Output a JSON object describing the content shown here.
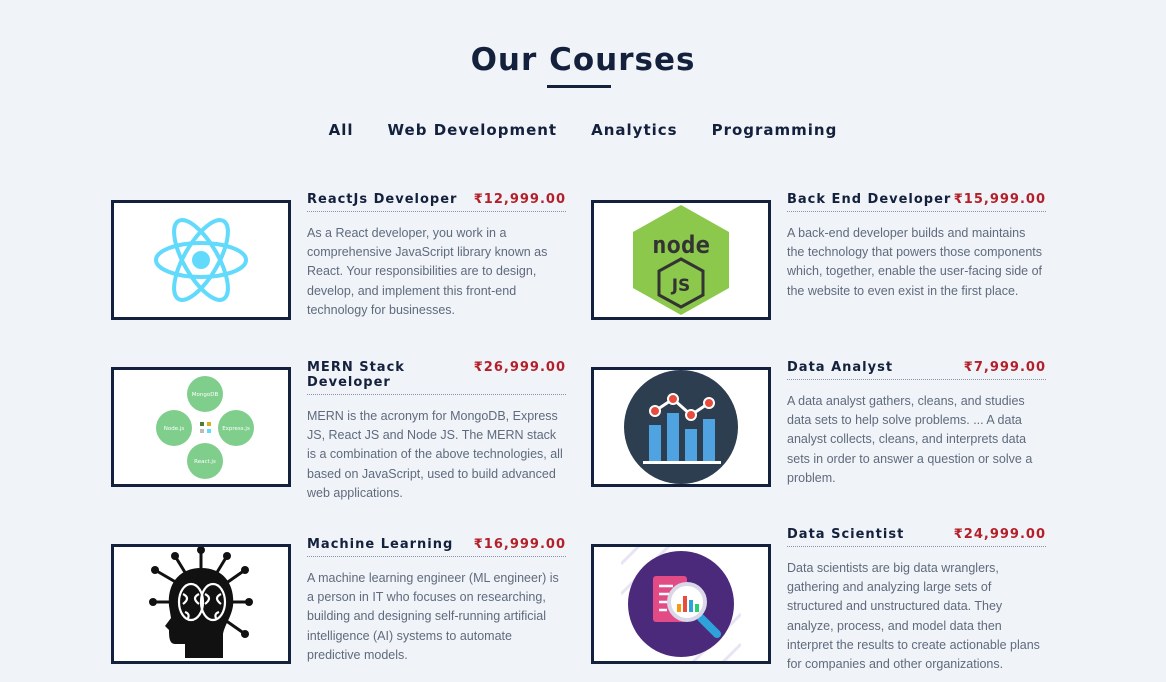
{
  "page": {
    "title": "Our Courses"
  },
  "filters": [
    "All",
    "Web Development",
    "Analytics",
    "Programming"
  ],
  "courses": [
    {
      "name": "ReactJs Developer",
      "price": "₹12,999.00",
      "icon": "react-logo-icon",
      "description": "As a React developer, you work in a comprehensive JavaScript library known as React. Your responsibilities are to design, develop, and implement this front-end technology for businesses."
    },
    {
      "name": "Back End Developer",
      "price": "₹15,999.00",
      "icon": "nodejs-logo-icon",
      "description": "A back-end developer builds and maintains the technology that powers those components which, together, enable the user-facing side of the website to even exist in the first place."
    },
    {
      "name": "MERN Stack Developer",
      "price": "₹26,999.00",
      "icon": "mern-diagram-icon",
      "labels": [
        "MongoDB",
        "Node.js",
        "Express.js",
        "React.js"
      ],
      "description": "MERN is the acronym for MongoDB, Express JS, React JS and Node JS. The MERN stack is a combination of the above technologies, all based on JavaScript, used to build advanced web applications."
    },
    {
      "name": "Data Analyst",
      "price": "₹7,999.00",
      "icon": "bar-chart-icon",
      "description": "A data analyst gathers, cleans, and studies data sets to help solve problems. ... A data analyst collects, cleans, and interprets data sets in order to answer a question or solve a problem."
    },
    {
      "name": "Machine Learning",
      "price": "₹16,999.00",
      "icon": "brain-head-icon",
      "description": "A machine learning engineer (ML engineer) is a person in IT who focuses on researching, building and designing self-running artificial intelligence (AI) systems to automate predictive models."
    },
    {
      "name": "Data Scientist",
      "price": "₹24,999.00",
      "icon": "data-magnifier-icon",
      "description": "Data scientists are big data wranglers, gathering and analyzing large sets of structured and unstructured data. They analyze, process, and model data then interpret the results to create actionable plans for companies and other organizations."
    }
  ],
  "colors": {
    "heading": "#14213d",
    "price": "#b3202a",
    "text": "#5f6b7d",
    "background": "#f0f3f7"
  }
}
